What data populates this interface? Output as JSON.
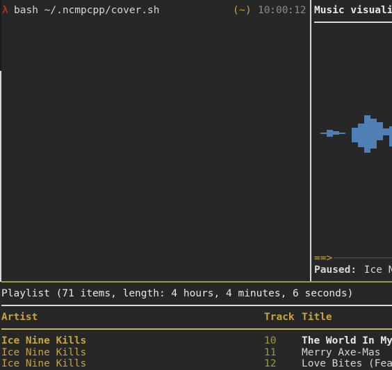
{
  "terminal": {
    "prompt_symbol": "λ",
    "command": "bash ~/.ncmpcpp/cover.sh",
    "dir_open": "(",
    "dir": "~",
    "dir_close": ")",
    "clock_h": "10",
    "clock_sep1": ":",
    "clock_m": "00",
    "clock_sep2": ":",
    "clock_s": "12"
  },
  "visualizer": {
    "title": "Music visuali",
    "progress_arrow": "==>",
    "status_label": "Paused:",
    "status_text": " Ice N"
  },
  "playlist": {
    "header": "Playlist (71 items, length: 4 hours, 4 minutes, 6 seconds)",
    "columns": {
      "artist": "Artist",
      "track": "Track",
      "title": "Title"
    },
    "rows": [
      {
        "artist": "Ice Nine Kills",
        "track": "10",
        "title": "The World In My"
      },
      {
        "artist": "Ice Nine Kills",
        "track": "11",
        "title": "Merry Axe-Mas"
      },
      {
        "artist": "Ice Nine Kills",
        "track": "12",
        "title": "Love Bites (Fea"
      }
    ]
  },
  "colors": {
    "background": "#272727",
    "prompt_red": "#d03a2c",
    "accent_gold": "#c6a63a",
    "track_olive": "#9c9a3c",
    "visualizer_blue": "#4f7fb4",
    "separator": "#d8d8d8"
  }
}
